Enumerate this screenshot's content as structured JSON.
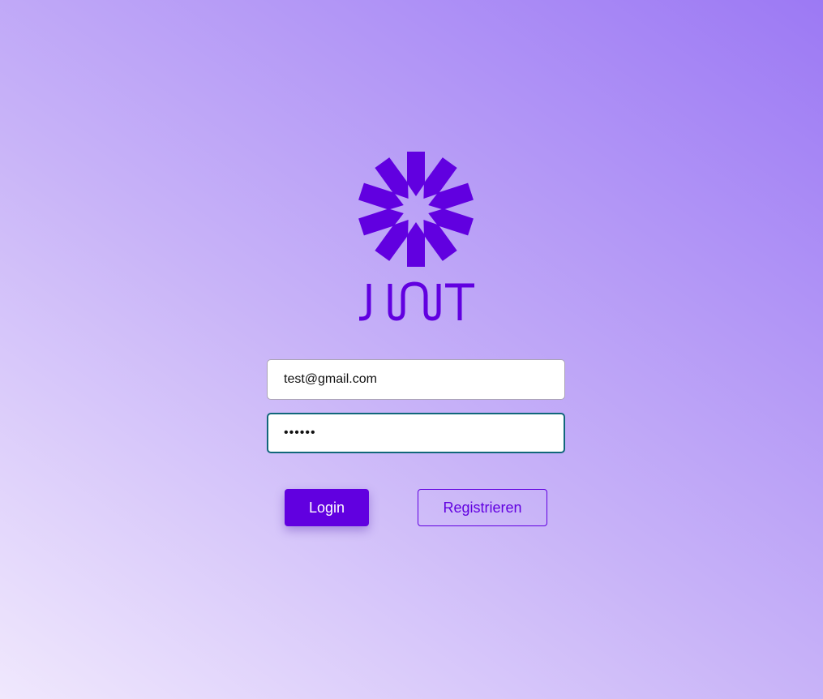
{
  "brand": {
    "logo_text": "JWT",
    "logo_icon": "jwt-logo-icon",
    "accent_color": "#6100e0"
  },
  "login_form": {
    "email_value": "test@gmail.com",
    "email_type": "email",
    "password_value": "••••••",
    "password_type": "password",
    "login_label": "Login",
    "register_label": "Registrieren"
  }
}
